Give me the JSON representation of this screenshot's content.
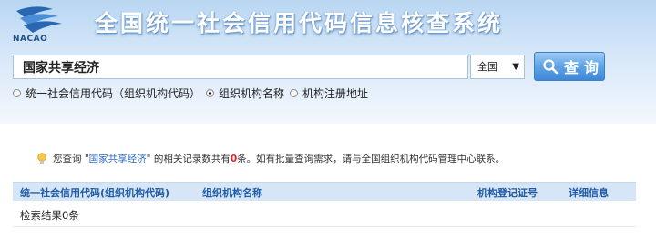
{
  "header": {
    "logo_text": "NACAO",
    "title": "全国统一社会信用代码信息核查系统"
  },
  "search": {
    "value": "国家共享经济",
    "region": "全国",
    "button_label": "查询"
  },
  "radio_options": [
    {
      "label": "统一社会信用代码（组织机构代码）",
      "checked": false
    },
    {
      "label": "组织机构名称",
      "checked": true
    },
    {
      "label": "机构注册地址",
      "checked": false
    }
  ],
  "notice": {
    "prefix": "您查询 \"",
    "keyword": "国家共享经济",
    "middle": "\" 的相关记录数共有",
    "count": "0",
    "suffix": "条。如有批量查询需求，请与全国组织机构代码管理中心联系。"
  },
  "table": {
    "columns": [
      "统一社会信用代码(组织机构代码)",
      "组织机构名称",
      "机构登记证号",
      "详细信息"
    ],
    "empty_message": "检索结果0条"
  },
  "colors": {
    "accent": "#1d5aa8",
    "highlight": "#e02222",
    "link": "#2a6bc2"
  }
}
